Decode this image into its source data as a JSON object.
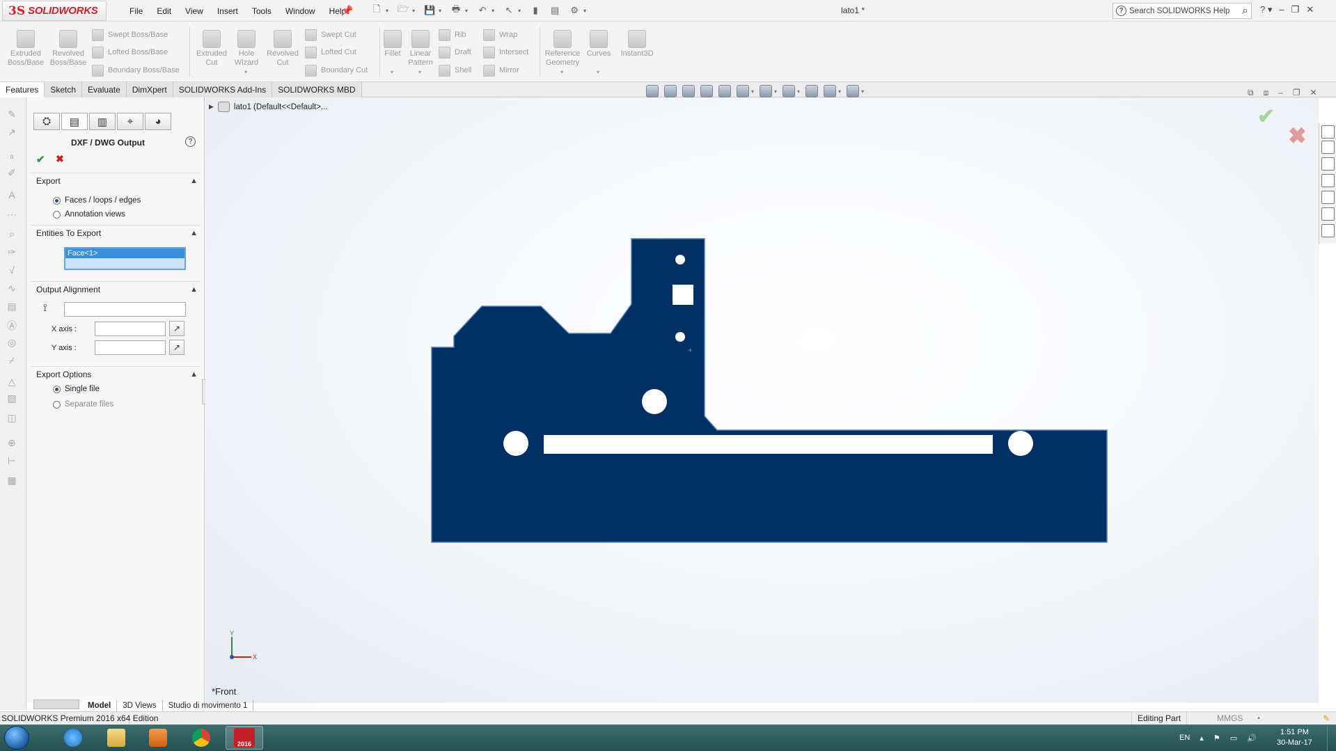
{
  "app": {
    "logo_ds": "3S",
    "logo_text": "SOLIDWORKS",
    "menu": [
      "File",
      "Edit",
      "View",
      "Insert",
      "Tools",
      "Window",
      "Help"
    ],
    "document_title": "lato1 *",
    "search_placeholder": "Search SOLIDWORKS Help"
  },
  "ribbon": {
    "big_buttons": [
      {
        "label": "Extruded Boss/Base"
      },
      {
        "label": "Revolved Boss/Base"
      },
      {
        "label": "Extruded Cut"
      },
      {
        "label": "Hole Wizard"
      },
      {
        "label": "Revolved Cut"
      },
      {
        "label": "Fillet"
      },
      {
        "label": "Linear Pattern"
      },
      {
        "label": "Reference Geometry"
      },
      {
        "label": "Curves"
      },
      {
        "label": "Instant3D"
      }
    ],
    "small_buttons": [
      {
        "label": "Swept Boss/Base"
      },
      {
        "label": "Lofted Boss/Base"
      },
      {
        "label": "Boundary Boss/Base"
      },
      {
        "label": "Swept Cut"
      },
      {
        "label": "Lofted Cut"
      },
      {
        "label": "Boundary Cut"
      },
      {
        "label": "Rib"
      },
      {
        "label": "Draft"
      },
      {
        "label": "Shell"
      },
      {
        "label": "Wrap"
      },
      {
        "label": "Intersect"
      },
      {
        "label": "Mirror"
      }
    ]
  },
  "command_tabs": [
    "Features",
    "Sketch",
    "Evaluate",
    "DimXpert",
    "SOLIDWORKS Add-Ins",
    "SOLIDWORKS MBD"
  ],
  "property_manager": {
    "title": "DXF / DWG Output",
    "export": {
      "header": "Export",
      "options": [
        "Faces / loops / edges",
        "Annotation views"
      ],
      "selected": "Faces / loops / edges"
    },
    "entities": {
      "header": "Entities To Export",
      "items": [
        "Face<1>"
      ]
    },
    "alignment": {
      "header": "Output Alignment",
      "origin_value": "",
      "x_axis_label": "X axis :",
      "x_axis_value": "",
      "y_axis_label": "Y axis :",
      "y_axis_value": ""
    },
    "export_options": {
      "header": "Export Options",
      "options": [
        "Single file",
        "Separate files"
      ],
      "selected": "Single file"
    }
  },
  "graphics": {
    "tree_label": "lato1  (Default<<Default>...",
    "view_label": "*Front",
    "part_color": "#002f63",
    "background_color": "#f4f6fa"
  },
  "model_tabs": [
    "Model",
    "3D Views",
    "Studio di movimento 1"
  ],
  "status_bar": {
    "edition": "SOLIDWORKS Premium 2016 x64 Edition",
    "mode": "Editing Part",
    "units": "MMGS"
  },
  "taskbar": {
    "language": "EN",
    "time": "1:51 PM",
    "date": "30-Mar-17",
    "sw_badge": "2016"
  }
}
